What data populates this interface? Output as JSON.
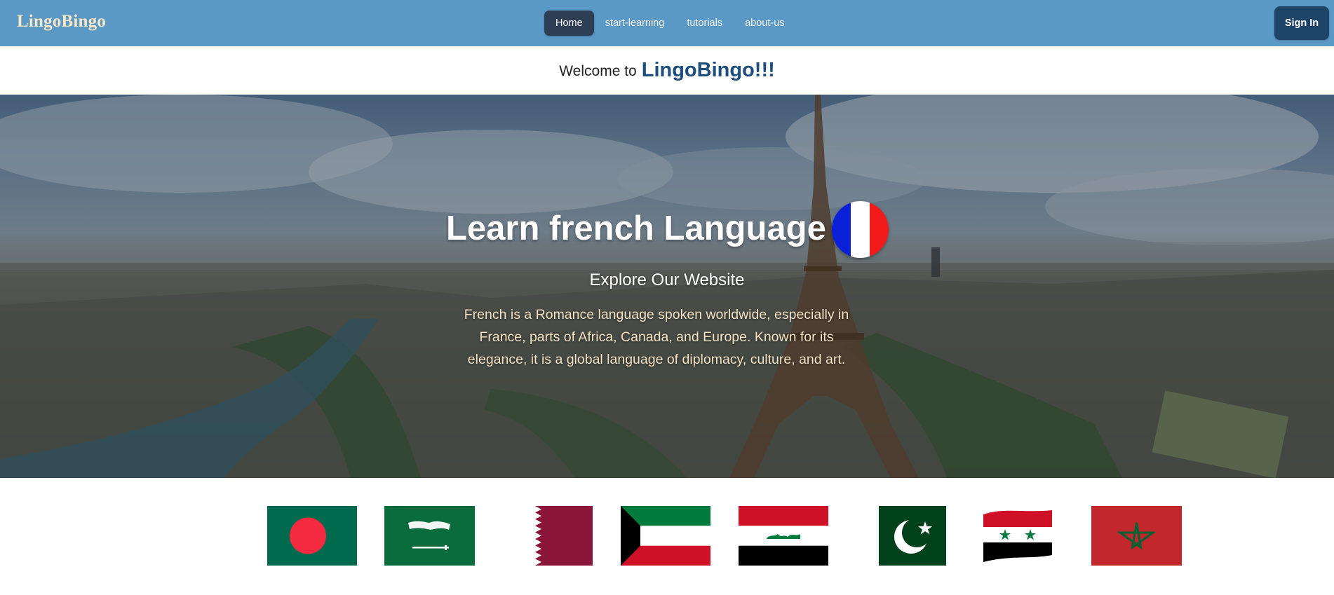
{
  "nav": {
    "brand": "LingoBingo",
    "links": [
      {
        "label": "Home",
        "active": true
      },
      {
        "label": "start-learning",
        "active": false
      },
      {
        "label": "tutorials",
        "active": false
      },
      {
        "label": "about-us",
        "active": false
      }
    ],
    "signin_label": "Sign In"
  },
  "welcome": {
    "prefix": "Welcome to",
    "brand": "LingoBingo!!!"
  },
  "hero": {
    "title": "Learn french Language",
    "flag_icon": "france-flag-icon",
    "subtitle": "Explore Our Website",
    "description": "French is a Romance language spoken worldwide, especially in France, parts of Africa, Canada, and Europe. Known for its elegance, it is a global language of diplomacy, culture, and art."
  },
  "flags": [
    {
      "icon": "bangladesh-flag-icon"
    },
    {
      "icon": "saudi-arabia-flag-icon"
    },
    {
      "icon": "qatar-flag-icon"
    },
    {
      "icon": "kuwait-flag-icon"
    },
    {
      "icon": "iraq-flag-icon"
    },
    {
      "icon": "pakistan-flag-icon"
    },
    {
      "icon": "syria-flag-icon"
    },
    {
      "icon": "morocco-flag-icon"
    }
  ],
  "colors": {
    "navbar": "#5a98c5",
    "brand_text": "#f6e6c8",
    "active_link": "#2e3f55",
    "signin_button": "#1e4468",
    "welcome_brand": "#1e4f7c",
    "hero_desc": "#f4e2c4"
  }
}
